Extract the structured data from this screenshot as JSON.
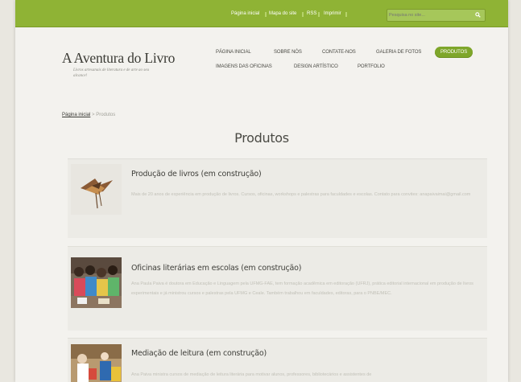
{
  "topbar": {
    "links": [
      "Página inicial",
      "Mapa do site",
      "RSS",
      "Imprimir"
    ],
    "search_placeholder": "Pesquisa no site...",
    "search_icon": "magnifier-icon"
  },
  "site": {
    "title": "A Aventura do Livro",
    "tagline": "Livros artesanais de literatura e de arte ao seu alcance!"
  },
  "nav": {
    "row1": [
      "PÁGINA INICIAL",
      "SOBRE NÓS",
      "CONTATE-NOS",
      "GALERIA DE FOTOS",
      "PRODUTOS"
    ],
    "row2": [
      "IMAGENS DAS OFICINAS",
      "DESIGN ARTÍSTICO",
      "PORTFOLIO"
    ],
    "active": "PRODUTOS"
  },
  "breadcrumb": {
    "home": "Página inicial",
    "separator": " > ",
    "current": "Produtos"
  },
  "page_title": "Produtos",
  "products": [
    {
      "title": "Produção de livros (em construção)",
      "text": "Mais de 20 anos de experiência em produção de livros. Cursos, oficinas, workshops e palestras para faculdades e escolas. Contato para convites: anapaivaimai@gmail.com"
    },
    {
      "title": "Oficinas literárias em escolas (em construção)",
      "text": "Ana Paula Paiva é doutora em Educação e Linguagem pela UFMG-FAE, tem formação acadêmica em editoração (UFRJ), prática editorial internacional em produção de livros experimentais e já ministrou cursos e palestras pela UFMG e Ceale. Também trabalhou em faculdades, editoras, para o PNBE/MEC."
    },
    {
      "title": "Mediação de leitura (em construção)",
      "text": "Ana Paiva ministra cursos de mediação de leitura literária para motivar alunos, professores, bibliotecários e assistentes de"
    }
  ]
}
